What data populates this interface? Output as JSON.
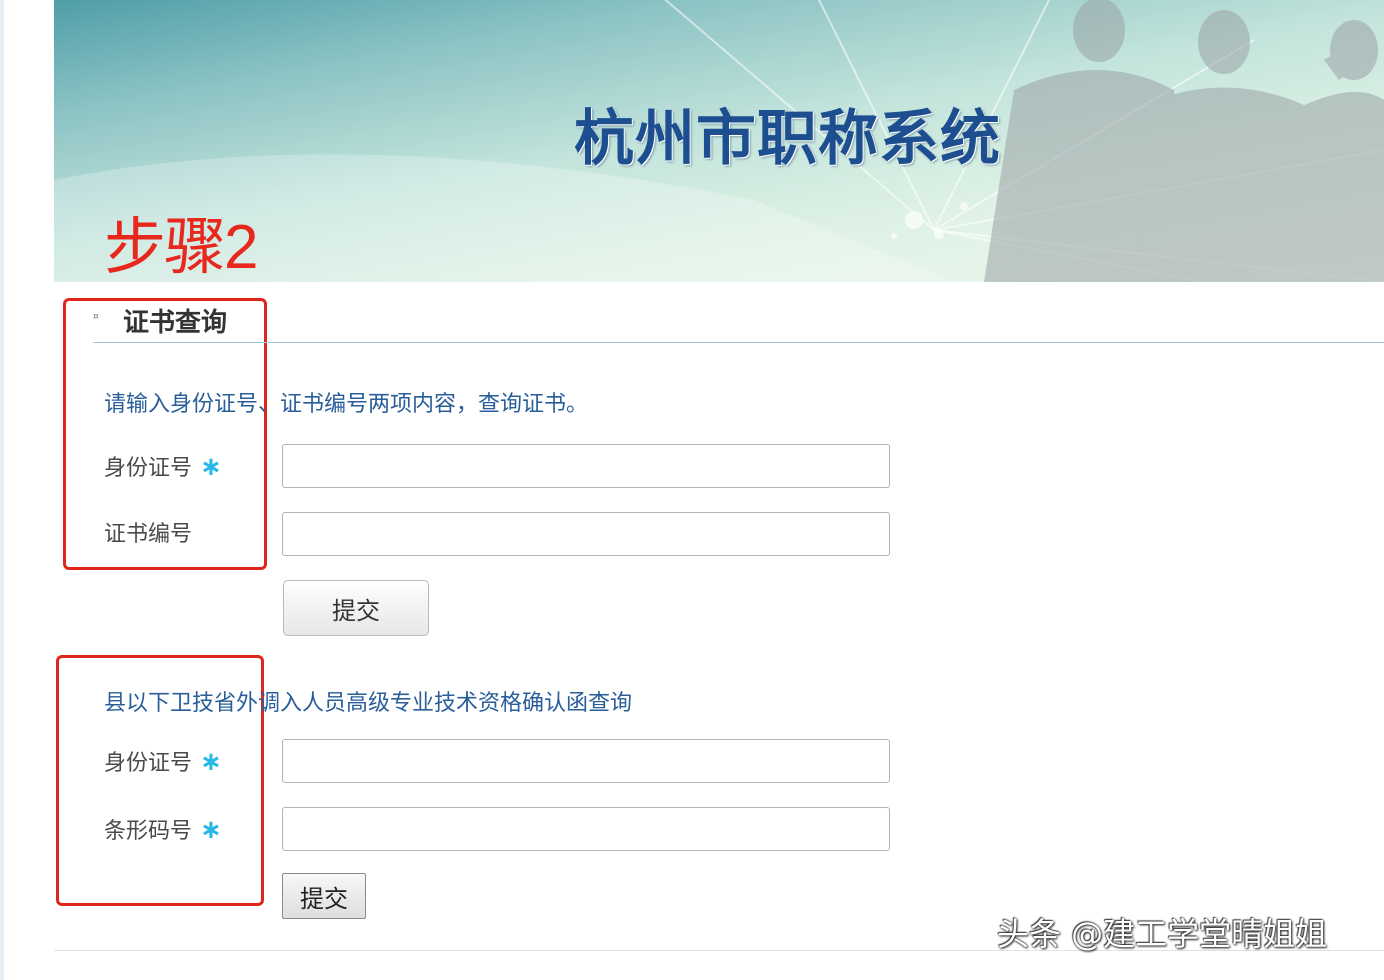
{
  "banner": {
    "title": "杭州市职称系统"
  },
  "annotation": {
    "step_label": "步骤2"
  },
  "certificate_query": {
    "title": "证书查询",
    "instruction": "请输入身份证号、证书编号两项内容，查询证书。",
    "id_label": "身份证号",
    "cert_no_label": "证书编号",
    "required_mark": "∗",
    "id_value": "",
    "cert_no_value": "",
    "submit_label": "提交"
  },
  "confirmation_query": {
    "instruction": "县以下卫技省外调入人员高级专业技术资格确认函查询",
    "id_label": "身份证号",
    "barcode_label": "条形码号",
    "required_mark": "∗",
    "id_value": "",
    "barcode_value": "",
    "submit_label": "提交"
  },
  "watermark": {
    "text": "头条 @建工学堂晴姐姐"
  },
  "colors": {
    "title_blue": "#1d4f90",
    "instruction_blue": "#2a5e9a",
    "required_cyan": "#27b8e8",
    "annotation_red": "#e0251a"
  }
}
